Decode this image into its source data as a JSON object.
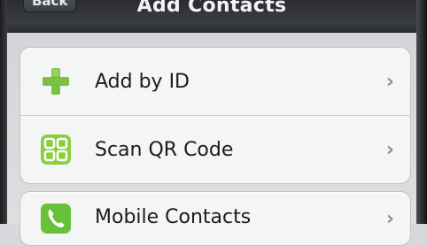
{
  "nav": {
    "back_label": "Back",
    "title": "Add Contacts"
  },
  "menu": {
    "group1": [
      {
        "label": "Add by ID",
        "icon": "plus-icon",
        "color": "#7ac043"
      },
      {
        "label": "Scan QR Code",
        "icon": "qr-code-icon",
        "color": "#8ccf3d"
      }
    ],
    "group2": [
      {
        "label": "Mobile Contacts",
        "icon": "phone-icon",
        "color": "#67c23a"
      }
    ]
  }
}
